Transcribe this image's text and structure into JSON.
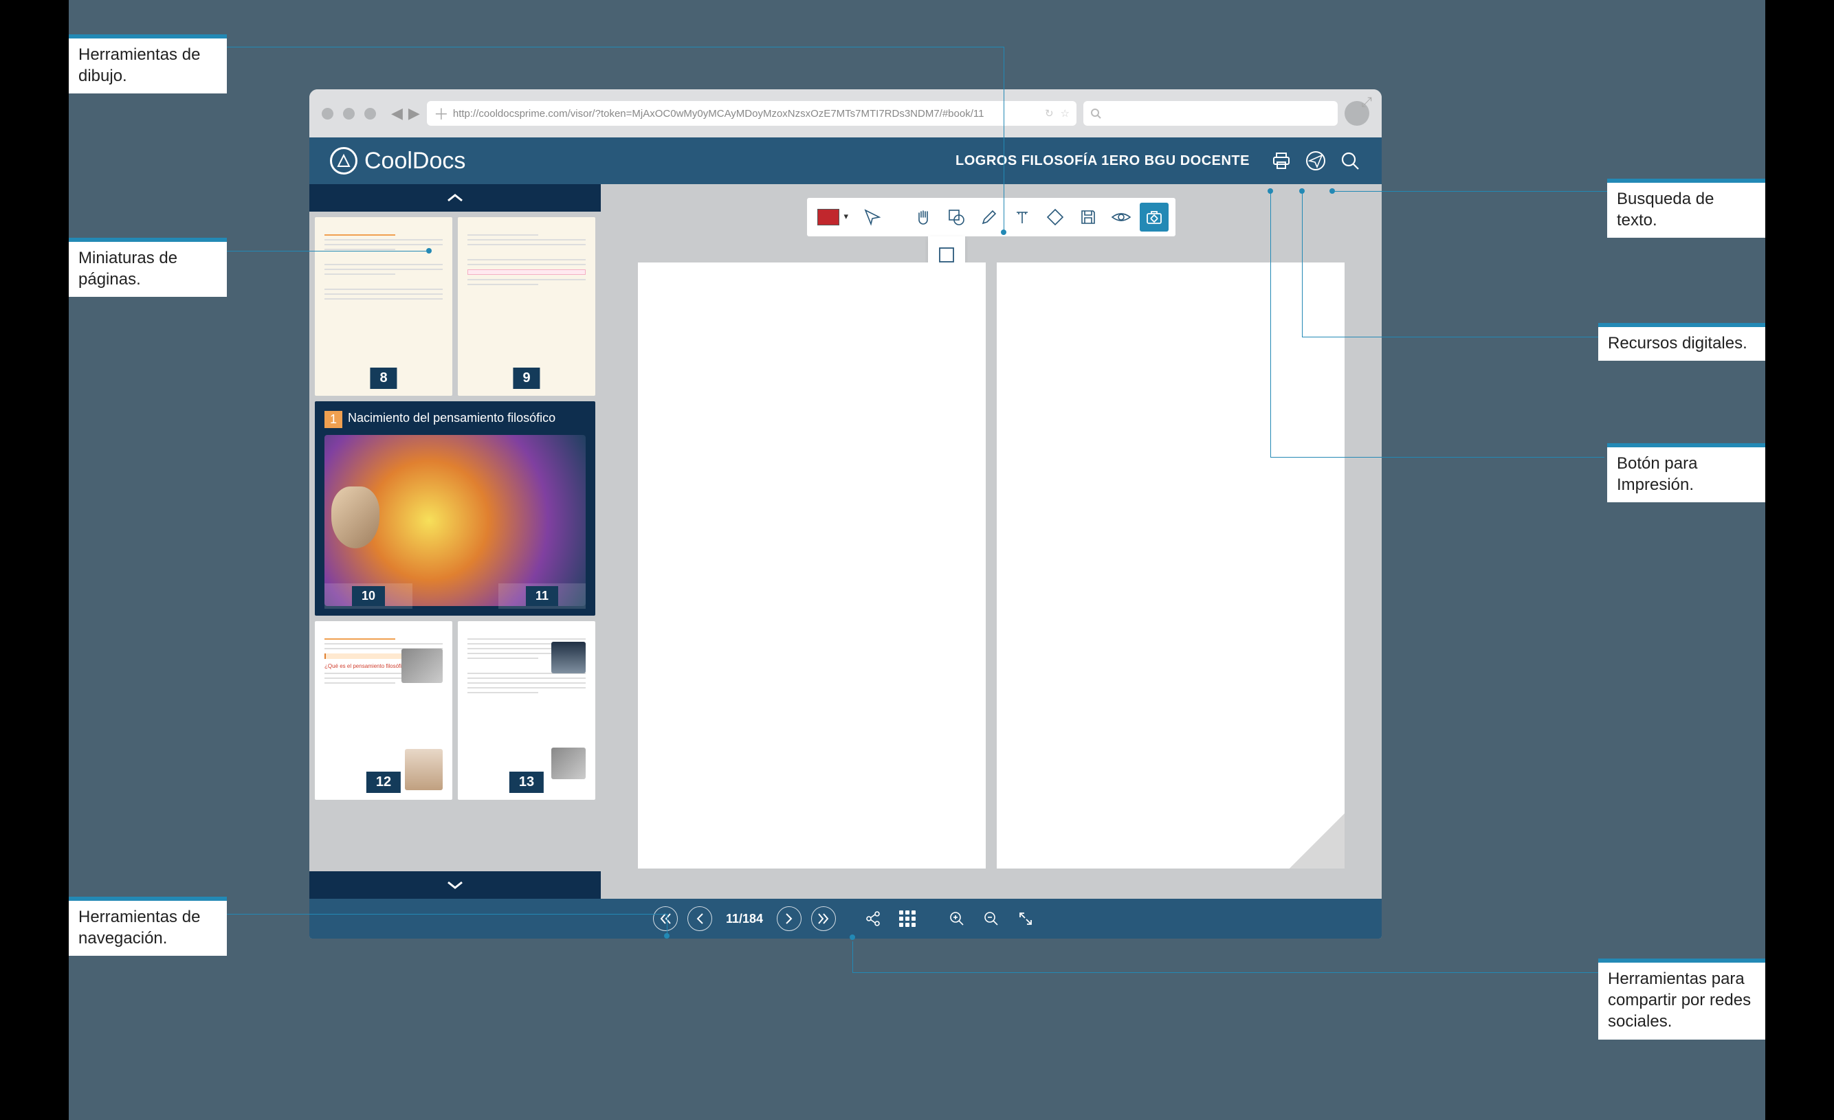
{
  "callouts": {
    "drawing_tools": "Herramientas de dibujo.",
    "thumbnails": "Miniaturas de páginas.",
    "navigation_tools": "Herramientas de navegación.",
    "text_search": "Busqueda de texto.",
    "digital_resources": "Recursos digitales.",
    "print_button": "Botón para Impresión.",
    "share_tools": "Herramientas para compartir por redes sociales."
  },
  "browser": {
    "url": "http://cooldocsprime.com/visor/?token=MjAxOC0wMy0yMCAyMDoyMzoxNzsxOzE7MTs7MTI7RDs3NDM7/#book/11",
    "search_placeholder": ""
  },
  "app": {
    "brand": "CoolDocs",
    "document_title": "LOGROS FILOSOFÍA 1ERO BGU DOCENTE"
  },
  "thumbnails": {
    "row1": {
      "left_page": "8",
      "right_page": "9"
    },
    "wide": {
      "unit_number": "1",
      "unit_title": "Nacimiento del pensamiento filosófico",
      "left_page": "10",
      "right_page": "11"
    },
    "row3": {
      "left_page": "12",
      "right_page": "13",
      "heading": "¿Qué es el pensamiento filosófico?"
    }
  },
  "toolbar": {
    "colors": {
      "fill": "#c1272d"
    },
    "shapes": [
      "square",
      "triangle",
      "circle"
    ],
    "tools": [
      "cursor",
      "pan",
      "shape",
      "pencil",
      "text",
      "eraser",
      "save",
      "visibility",
      "resources"
    ]
  },
  "footer": {
    "page_indicator": "11/184"
  }
}
